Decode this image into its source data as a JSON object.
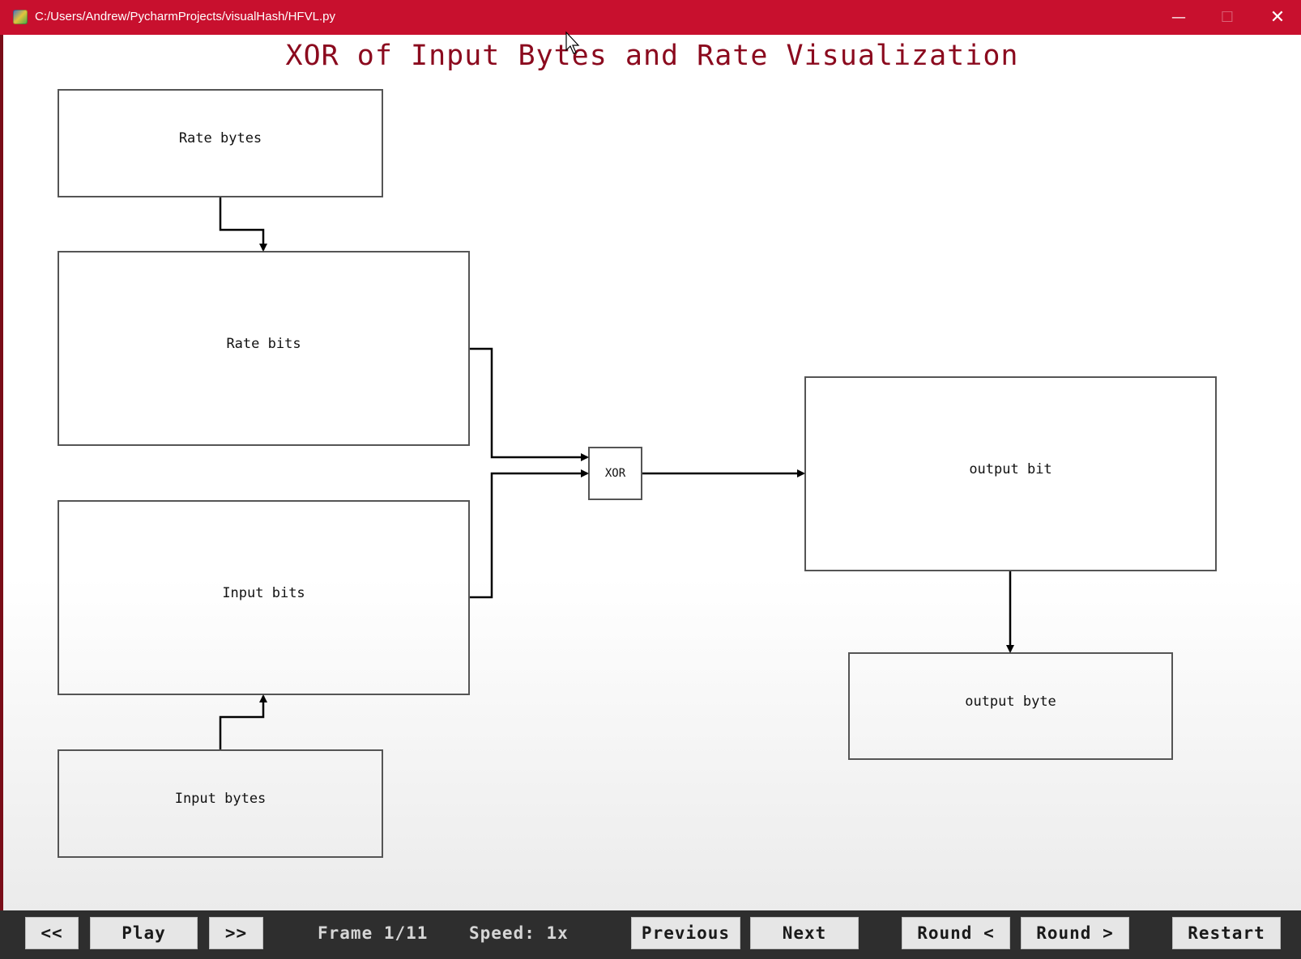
{
  "window": {
    "title": "C:/Users/Andrew/PycharmProjects/visualHash/HFVL.py",
    "minimize_glyph": "—",
    "maximize_glyph": "☐",
    "close_glyph": "✕",
    "titlebar_color": "#c8102e",
    "app_icon": "python-icon"
  },
  "visualization": {
    "title": "XOR of Input Bytes and Rate Visualization",
    "title_color": "#8b0a1e",
    "boxes": {
      "rate_bytes": "Rate bytes",
      "rate_bits": "Rate bits",
      "input_bits": "Input bits",
      "input_bytes": "Input bytes",
      "xor": "XOR",
      "output_bit": "output bit",
      "output_byte": "output byte"
    }
  },
  "controls": {
    "rewind_label": "<<",
    "play_label": "Play",
    "forward_label": ">>",
    "frame_text": "Frame 1/11",
    "speed_text": "Speed: 1x",
    "previous_label": "Previous",
    "next_label": "Next",
    "round_prev_label": "Round <",
    "round_next_label": "Round >",
    "restart_label": "Restart"
  }
}
